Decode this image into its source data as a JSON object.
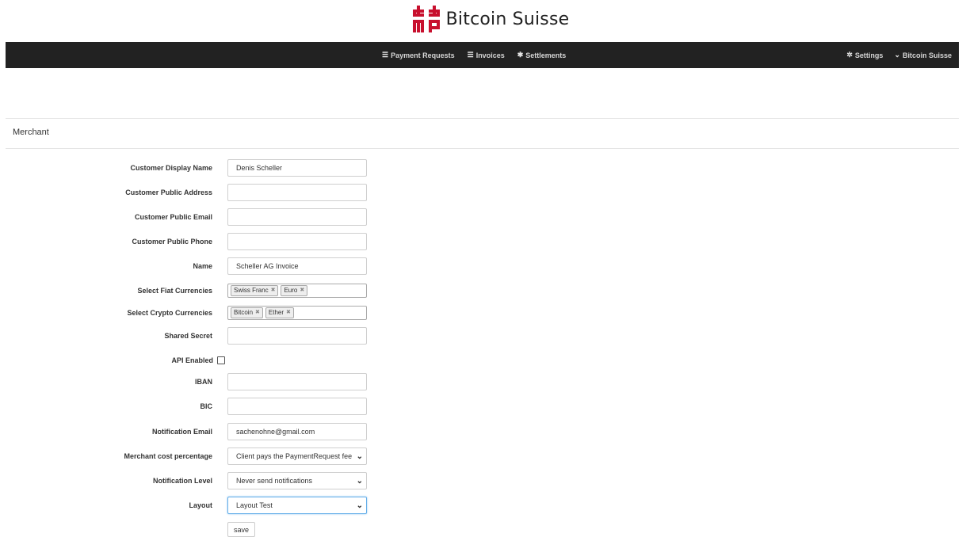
{
  "brand": {
    "name": "Bitcoin Suisse",
    "logo_color": "#c8102e"
  },
  "navbar": {
    "center": [
      {
        "icon": "list-icon",
        "label": "Payment Requests"
      },
      {
        "icon": "list-icon",
        "label": "Invoices"
      },
      {
        "icon": "piggy-bank-icon",
        "label": "Settlements"
      }
    ],
    "right": [
      {
        "icon": "gear-icon",
        "label": "Settings"
      },
      {
        "icon": "chevron-down-icon",
        "label": "Bitcoin Suisse"
      }
    ]
  },
  "section_title": "Merchant",
  "form": {
    "customer_display_name": {
      "label": "Customer Display Name",
      "value": "Denis Scheller"
    },
    "customer_public_address": {
      "label": "Customer Public Address",
      "value": ""
    },
    "customer_public_email": {
      "label": "Customer Public Email",
      "value": ""
    },
    "customer_public_phone": {
      "label": "Customer Public Phone",
      "value": ""
    },
    "name": {
      "label": "Name",
      "value": "Scheller AG Invoice"
    },
    "fiat_currencies": {
      "label": "Select Fiat Currencies",
      "tags": [
        "Swiss Franc",
        "Euro"
      ]
    },
    "crypto_currencies": {
      "label": "Select Crypto Currencies",
      "tags": [
        "Bitcoin",
        "Ether"
      ]
    },
    "shared_secret": {
      "label": "Shared Secret",
      "value": ""
    },
    "api_enabled": {
      "label": "API Enabled",
      "checked": false
    },
    "iban": {
      "label": "IBAN",
      "value": ""
    },
    "bic": {
      "label": "BIC",
      "value": ""
    },
    "notification_email": {
      "label": "Notification Email",
      "value": "sachenohne@gmail.com"
    },
    "merchant_cost_percentage": {
      "label": "Merchant cost percentage",
      "selected": "Client pays the PaymentRequest fee"
    },
    "notification_level": {
      "label": "Notification Level",
      "selected": "Never send notifications"
    },
    "layout": {
      "label": "Layout",
      "selected": "Layout Test"
    },
    "save_label": "save"
  }
}
